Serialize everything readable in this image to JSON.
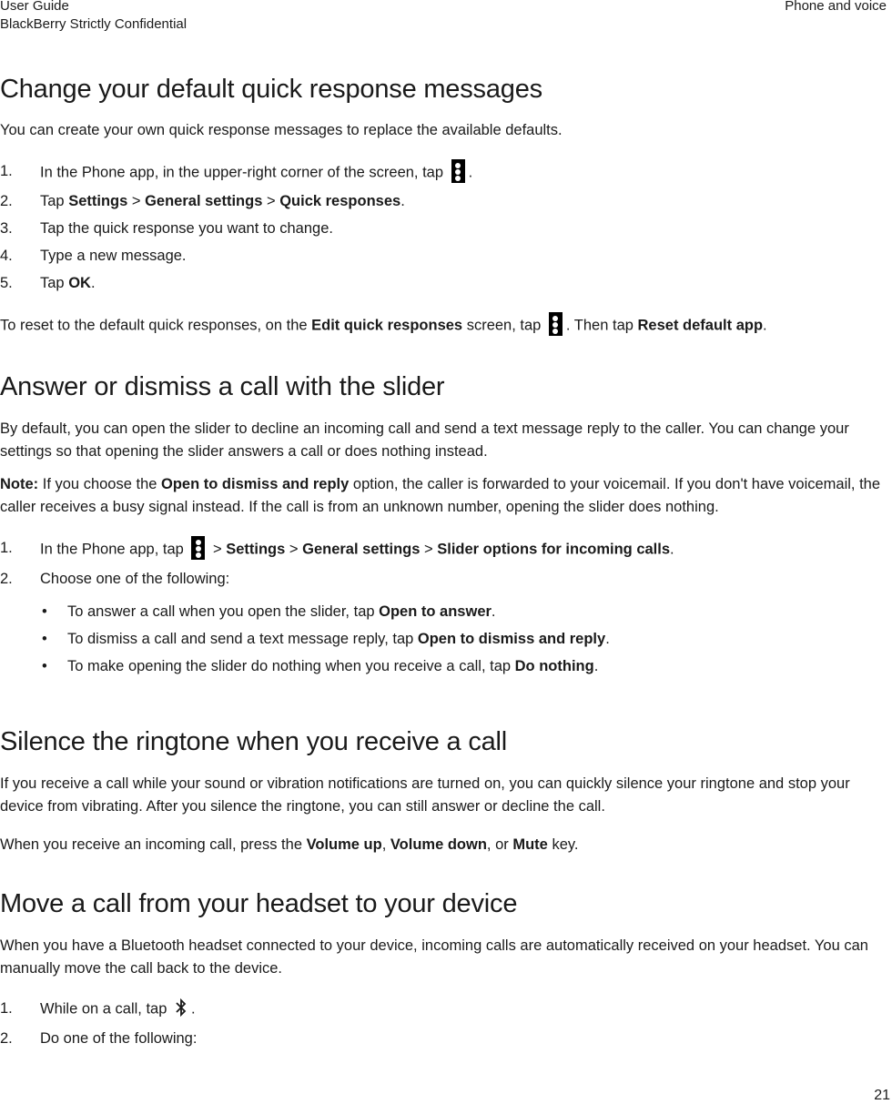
{
  "header": {
    "left_line1": "User Guide",
    "left_line2": "BlackBerry Strictly Confidential",
    "right": "Phone and voice"
  },
  "sections": [
    {
      "title": "Change your default quick response messages",
      "intro": "You can create your own quick response messages to replace the available defaults.",
      "steps": [
        {
          "num": "1.",
          "pre": "In the Phone app, in the upper-right corner of the screen, tap",
          "icon": "more-menu-icon",
          "post": "."
        },
        {
          "num": "2.",
          "pre": "Tap ",
          "b1": "Settings",
          "s1": " > ",
          "b2": "General settings",
          "s2": " > ",
          "b3": "Quick responses",
          "post": "."
        },
        {
          "num": "3.",
          "text": "Tap the quick response you want to change."
        },
        {
          "num": "4.",
          "text": "Type a new message."
        },
        {
          "num": "5.",
          "pre": "Tap ",
          "b1": "OK",
          "post": "."
        }
      ],
      "reset": {
        "pre": "To reset to the default quick responses, on the ",
        "b1": "Edit quick responses",
        "mid": " screen, tap",
        "icon": "more-menu-icon",
        "mid2": ". Then tap ",
        "b2": "Reset default app",
        "post": "."
      }
    },
    {
      "title": "Answer or dismiss a call with the slider",
      "intro": "By default, you can open the slider to decline an incoming call and send a text message reply to the caller. You can change your settings so that opening the slider answers a call or does nothing instead.",
      "note": {
        "label": "Note:",
        "pre": " If you choose the ",
        "b1": "Open to dismiss and reply",
        "post": " option, the caller is forwarded to your voicemail. If you don't have voicemail, the caller receives a busy signal instead. If the call is from an unknown number, opening the slider does nothing."
      },
      "steps": [
        {
          "num": "1.",
          "pre": "In the Phone app, tap",
          "icon": "more-menu-icon",
          "s0": " > ",
          "b1": "Settings",
          "s1": " > ",
          "b2": "General settings",
          "s2": " > ",
          "b3": "Slider options for incoming calls",
          "post": "."
        },
        {
          "num": "2.",
          "text": "Choose one of the following:"
        }
      ],
      "bullets": [
        {
          "pre": "To answer a call when you open the slider, tap ",
          "b": "Open to answer",
          "post": "."
        },
        {
          "pre": "To dismiss a call and send a text message reply, tap ",
          "b": "Open to dismiss and reply",
          "post": "."
        },
        {
          "pre": "To make opening the slider do nothing when you receive a call, tap ",
          "b": "Do nothing",
          "post": "."
        }
      ]
    },
    {
      "title": "Silence the ringtone when you receive a call",
      "intro": "If you receive a call while your sound or vibration notifications are turned on, you can quickly silence your ringtone and stop your device from vibrating. After you silence the ringtone, you can still answer or decline the call.",
      "para": {
        "pre": "When you receive an incoming call, press the ",
        "b1": "Volume up",
        "s1": ", ",
        "b2": "Volume down",
        "s2": ", or ",
        "b3": "Mute",
        "post": " key."
      }
    },
    {
      "title": "Move a call from your headset to your device",
      "intro": "When you have a Bluetooth headset connected to your device, incoming calls are automatically received on your headset. You can manually move the call back to the device.",
      "steps": [
        {
          "num": "1.",
          "pre": "While on a call, tap",
          "icon": "bluetooth-icon",
          "post": "."
        },
        {
          "num": "2.",
          "text": "Do one of the following:"
        }
      ]
    }
  ],
  "footer": {
    "page_number": "21"
  }
}
